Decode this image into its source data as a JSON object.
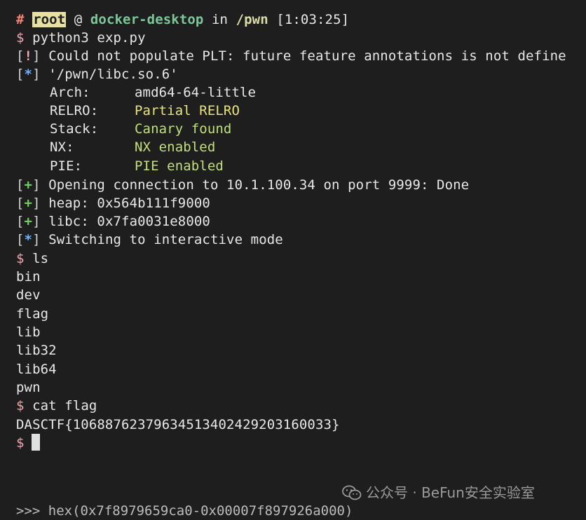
{
  "prompt_header": {
    "hash": "#",
    "user": "root",
    "at": "@",
    "host": "docker-desktop",
    "in": "in",
    "dir": "/pwn",
    "time": "[1:03:25]"
  },
  "commands": {
    "prompt_symbol": "$",
    "cmd1": "python3 exp.py",
    "cmd2": "ls",
    "cmd3": "cat flag"
  },
  "output": {
    "warn_tag": "!",
    "warn_text": "Could not populate PLT: future feature annotations is not define",
    "info_tag": "*",
    "libc_path": "'/pwn/libc.so.6'",
    "checksec": [
      {
        "key": "Arch:",
        "value": "amd64-64-little"
      },
      {
        "key": "RELRO:",
        "value": "Partial RELRO"
      },
      {
        "key": "Stack:",
        "value": "Canary found"
      },
      {
        "key": "NX:",
        "value": "NX enabled"
      },
      {
        "key": "PIE:",
        "value": "PIE enabled"
      }
    ],
    "plus_tag": "+",
    "conn_text": "Opening connection to 10.1.100.34 on port 9999: Done",
    "heap_text": "heap: 0x564b111f9000",
    "libc_text": "libc: 0x7fa0031e8000",
    "interactive_text": "Switching to interactive mode",
    "ls_entries": [
      "bin",
      "dev",
      "flag",
      "lib",
      "lib32",
      "lib64",
      "pwn"
    ],
    "flag_value": "DASCTF{10688762379634513402429203160033}",
    "cut_line": ">>> hex(0x7f8979659ca0-0x00007f897926a000)"
  },
  "colors": {
    "background": "#1e1e1e",
    "foreground": "#d4d4d4",
    "user_highlight": "#e8e0a2",
    "host": "#7ec699",
    "value_yellow": "#e9e57a",
    "value_green": "#c0e07a"
  },
  "watermark": {
    "icon": "wechat-icon",
    "text": "公众号 · BeFun安全实验室"
  }
}
